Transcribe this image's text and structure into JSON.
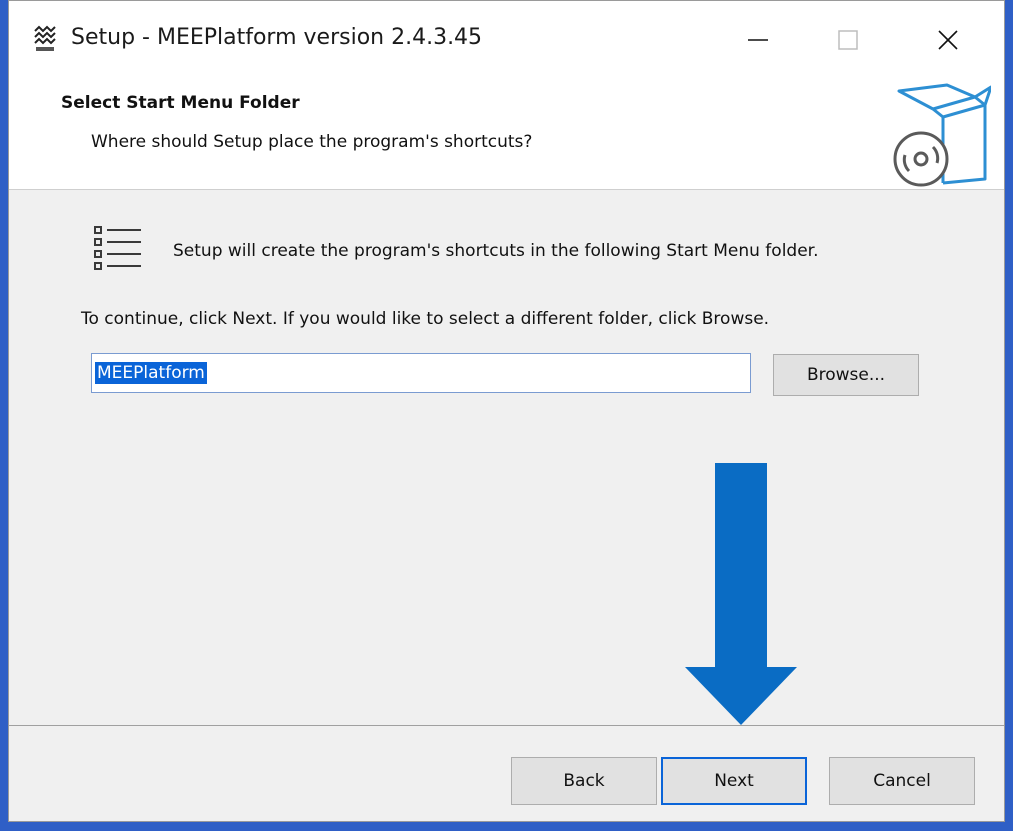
{
  "window": {
    "title": "Setup - MEEPlatform version 2.4.3.45",
    "minimize_label": "—",
    "maximize_label": "☐",
    "close_label": "✕"
  },
  "header": {
    "title": "Select Start Menu Folder",
    "subtitle": "Where should Setup place the program's shortcuts?"
  },
  "body": {
    "info_text": "Setup will create the program's shortcuts in the following Start Menu folder.",
    "continue_text": "To continue, click Next. If you would like to select a different folder, click Browse.",
    "folder_value": "MEEPlatform",
    "browse_label": "Browse..."
  },
  "footer": {
    "back_label": "Back",
    "next_label": "Next",
    "cancel_label": "Cancel"
  },
  "icons": {
    "app": "installer-app-icon",
    "header": "software-box-disc-icon",
    "list": "list-icon",
    "annotation": "down-arrow"
  },
  "colors": {
    "background": "#2f5fc6",
    "selection": "#0a64d8",
    "arrow": "#0a6cc4"
  }
}
